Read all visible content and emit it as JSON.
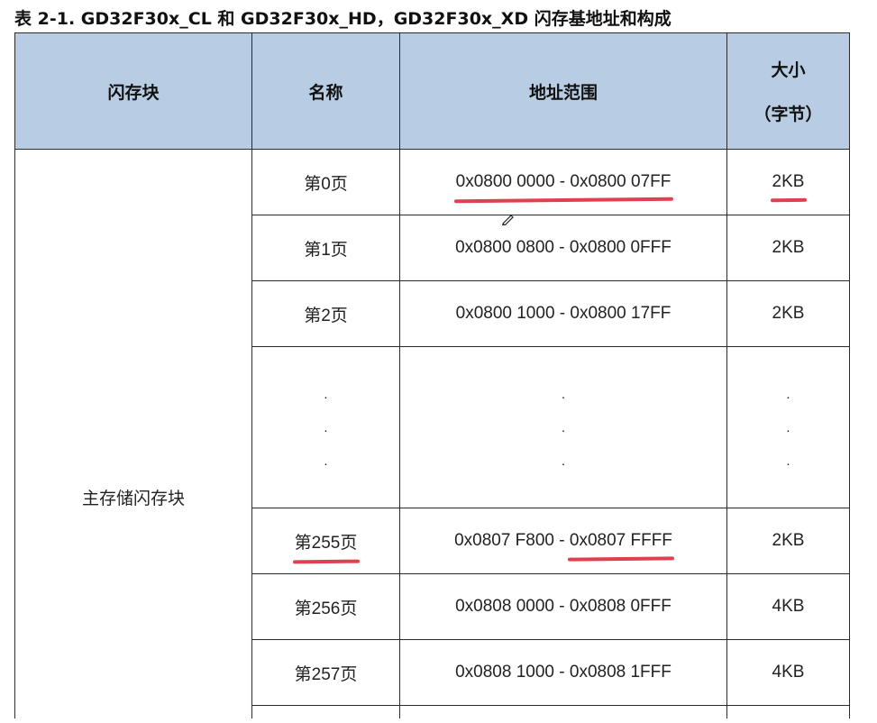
{
  "caption": "表 2-1. GD32F30x_CL 和 GD32F30x_HD，GD32F30x_XD 闪存基地址和构成",
  "headers": {
    "block": "闪存块",
    "name": "名称",
    "address": "地址范围",
    "size_line1": "大小",
    "size_line2": "（字节）"
  },
  "block_name": "主存储闪存块",
  "rows": [
    {
      "page_prefix": "第",
      "page_num": "0",
      "page_suffix": "页",
      "address": "0x0800 0000 - 0x0800 07FF",
      "size": "2KB"
    },
    {
      "page_prefix": "第",
      "page_num": "1",
      "page_suffix": "页",
      "address": "0x0800 0800 - 0x0800 0FFF",
      "size": "2KB"
    },
    {
      "page_prefix": "第",
      "page_num": "2",
      "page_suffix": "页",
      "address": "0x0800 1000 - 0x0800 17FF",
      "size": "2KB"
    },
    {
      "page_prefix": "第",
      "page_num": "255",
      "page_suffix": "页",
      "address_part1": "0x0807 F800 - ",
      "address_part2": "0x0807 FFFF",
      "size": "2KB"
    },
    {
      "page_prefix": "第",
      "page_num": "256",
      "page_suffix": "页",
      "address": "0x0808 0000 - 0x0808 0FFF",
      "size": "4KB"
    },
    {
      "page_prefix": "第",
      "page_num": "257",
      "page_suffix": "页",
      "address": "0x0808 1000 - 0x0808 1FFF",
      "size": "4KB"
    }
  ],
  "ellipsis_dot": ".",
  "annotation_color": "#e0404f",
  "icons": {
    "cursor": "pen-cursor-icon"
  }
}
